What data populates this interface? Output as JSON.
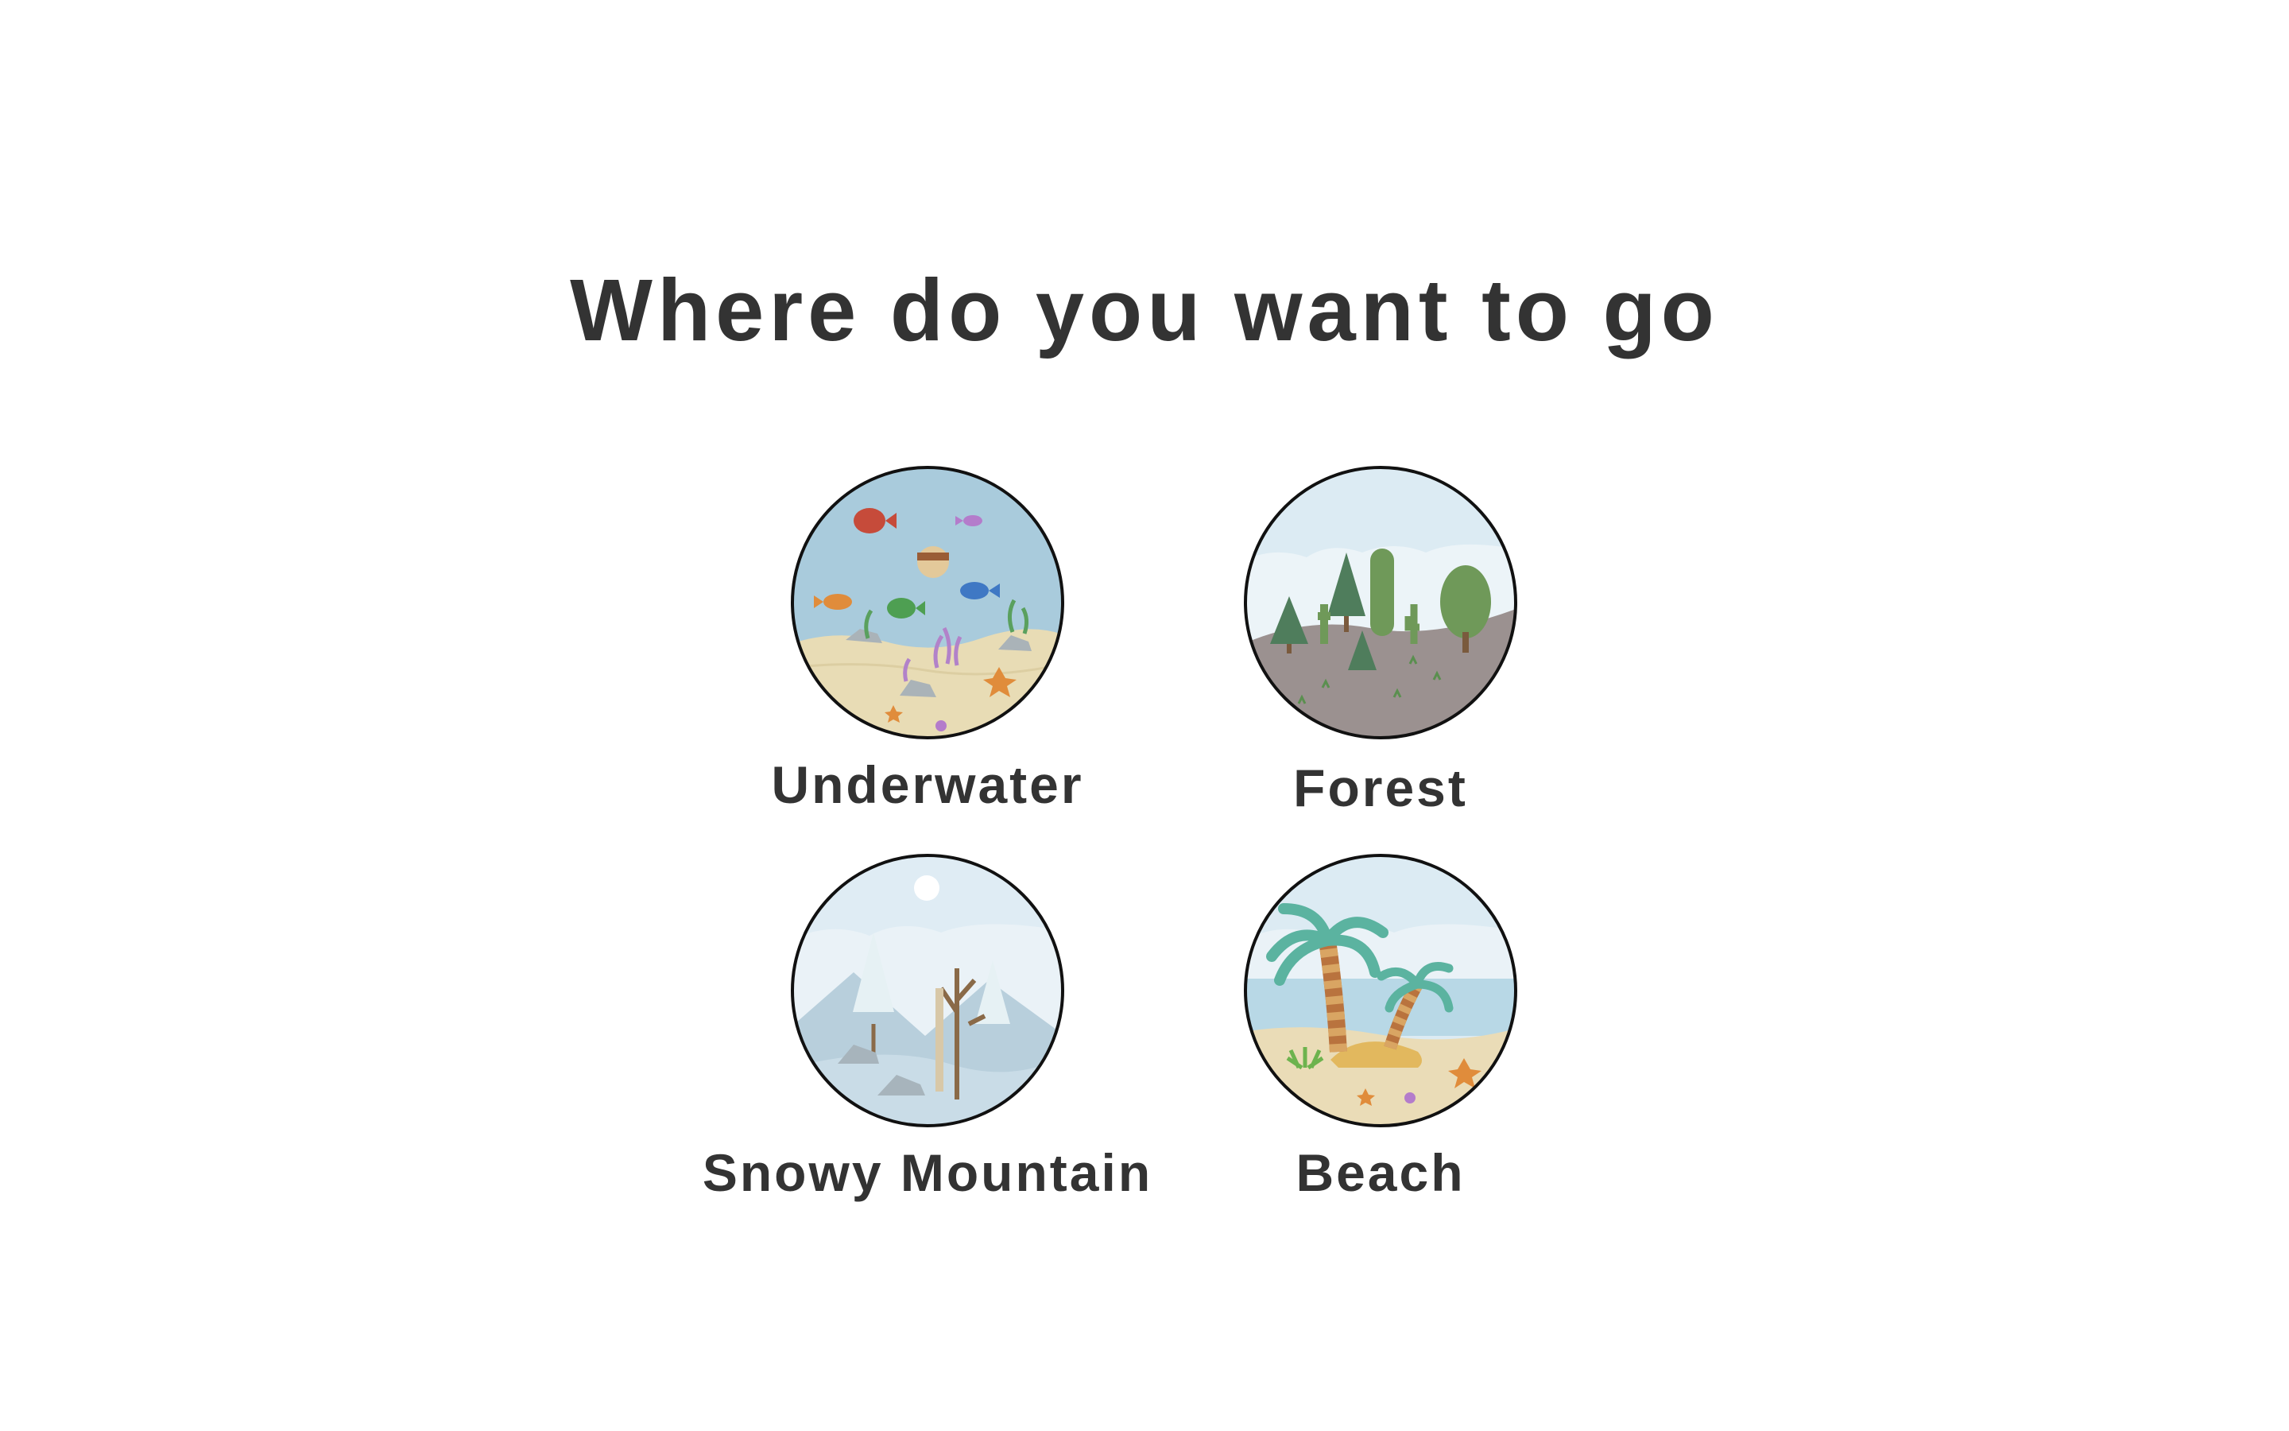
{
  "page": {
    "title": "Where do you want to go"
  },
  "destinations": [
    {
      "id": "underwater",
      "label": "Underwater",
      "icon": "underwater-scene-icon"
    },
    {
      "id": "forest",
      "label": "Forest",
      "icon": "forest-scene-icon"
    },
    {
      "id": "snowy-mountain",
      "label": "Snowy Mountain",
      "icon": "snowy-mountain-scene-icon"
    },
    {
      "id": "beach",
      "label": "Beach",
      "icon": "beach-scene-icon"
    }
  ],
  "colors": {
    "text": "#333333",
    "background": "#ffffff",
    "circle_border": "#111111",
    "water": "#a9cbdc",
    "sand": "#e8dcb5",
    "forest_sky": "#dcebf3",
    "forest_ground": "#9b9190",
    "snow_sky": "#dfecf4",
    "beach_sea": "#b8d8e6"
  }
}
